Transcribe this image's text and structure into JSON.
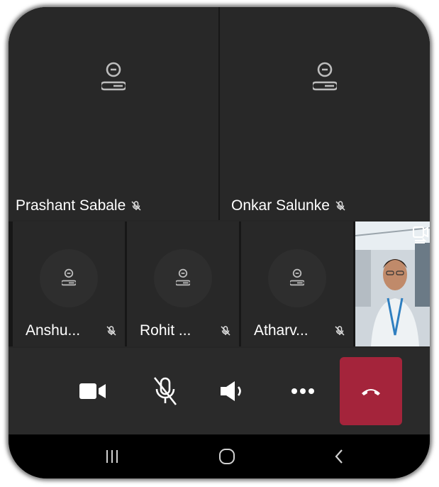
{
  "participants_top": [
    {
      "name": "Prashant Sabale",
      "muted": true
    },
    {
      "name": "Onkar Salunke",
      "muted": true
    }
  ],
  "participants_mid": [
    {
      "name": "Anshu...",
      "muted": true
    },
    {
      "name": "Rohit ...",
      "muted": true
    },
    {
      "name": "Atharv...",
      "muted": true
    }
  ],
  "controls": {
    "camera": "video-camera-icon",
    "mic": "microphone-off-icon",
    "speaker": "speaker-icon",
    "more": "more-options-icon",
    "end_call": "end-call-icon"
  },
  "colors": {
    "background": "#262626",
    "tile": "#282828",
    "end_call": "#a4243b",
    "text": "#ffffff"
  },
  "navbar": [
    "recent-apps-icon",
    "home-icon",
    "back-icon"
  ]
}
